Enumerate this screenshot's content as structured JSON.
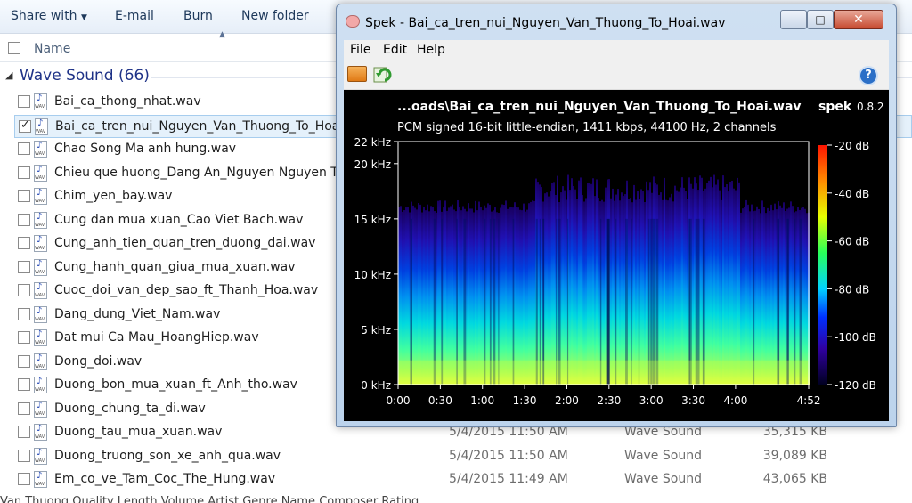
{
  "explorer": {
    "toolbar": {
      "share_with": "Share with",
      "email": "E-mail",
      "burn": "Burn",
      "new_folder": "New folder"
    },
    "column_name": "Name",
    "group": {
      "title": "Wave Sound (66)"
    },
    "files": [
      {
        "name": "Bai_ca_thong_nhat.wav",
        "date": "",
        "type": "",
        "size": "",
        "selected": false
      },
      {
        "name": "Bai_ca_tren_nui_Nguyen_Van_Thuong_To_Hoai.wav",
        "date": "",
        "type": "",
        "size": "",
        "selected": true
      },
      {
        "name": "Chao Song Ma anh hung.wav",
        "date": "",
        "type": "",
        "size": "",
        "selected": false
      },
      {
        "name": "Chieu que huong_Dang An_Nguyen Nguyen Thua",
        "date": "",
        "type": "",
        "size": "",
        "selected": false
      },
      {
        "name": "Chim_yen_bay.wav",
        "date": "",
        "type": "",
        "size": "",
        "selected": false
      },
      {
        "name": "Cung dan mua xuan_Cao Viet Bach.wav",
        "date": "",
        "type": "",
        "size": "",
        "selected": false
      },
      {
        "name": "Cung_anh_tien_quan_tren_duong_dai.wav",
        "date": "",
        "type": "",
        "size": "",
        "selected": false
      },
      {
        "name": "Cung_hanh_quan_giua_mua_xuan.wav",
        "date": "",
        "type": "",
        "size": "",
        "selected": false
      },
      {
        "name": "Cuoc_doi_van_dep_sao_ft_Thanh_Hoa.wav",
        "date": "",
        "type": "",
        "size": "",
        "selected": false
      },
      {
        "name": "Dang_dung_Viet_Nam.wav",
        "date": "",
        "type": "",
        "size": "",
        "selected": false
      },
      {
        "name": "Dat mui Ca Mau_HoangHiep.wav",
        "date": "",
        "type": "",
        "size": "",
        "selected": false
      },
      {
        "name": "Dong_doi.wav",
        "date": "",
        "type": "",
        "size": "",
        "selected": false
      },
      {
        "name": "Duong_bon_mua_xuan_ft_Anh_tho.wav",
        "date": "",
        "type": "",
        "size": "",
        "selected": false
      },
      {
        "name": "Duong_chung_ta_di.wav",
        "date": "",
        "type": "",
        "size": "",
        "selected": false
      },
      {
        "name": "Duong_tau_mua_xuan.wav",
        "date": "5/4/2015 11:50 AM",
        "type": "Wave Sound",
        "size": "35,315 KB",
        "selected": false
      },
      {
        "name": "Duong_truong_son_xe_anh_qua.wav",
        "date": "5/4/2015 11:50 AM",
        "type": "Wave Sound",
        "size": "39,089 KB",
        "selected": false
      },
      {
        "name": "Em_co_ve_Tam_Coc_The_Hung.wav",
        "date": "5/4/2015 11:49 AM",
        "type": "Wave Sound",
        "size": "43,065 KB",
        "selected": false
      }
    ],
    "bottom_text": "Van Thuong   Quality   Length   Volume   Artist   Genre   Name   Composer   Rating"
  },
  "spek": {
    "window_title": "Spek - Bai_ca_tren_nui_Nguyen_Van_Thuong_To_Hoai.wav",
    "menu": [
      "File",
      "Edit",
      "Help"
    ],
    "file_label": "...oads\\Bai_ca_tren_nui_Nguyen_Van_Thuong_To_Hoai.wav",
    "app_name": "spek",
    "version": "0.8.2",
    "audio_info": "PCM signed 16-bit little-endian, 1411 kbps, 44100 Hz, 2 channels",
    "freq_ticks": [
      {
        "label": "22 kHz",
        "khz": 22
      },
      {
        "label": "20 kHz",
        "khz": 20
      },
      {
        "label": "15 kHz",
        "khz": 15
      },
      {
        "label": "10 kHz",
        "khz": 10
      },
      {
        "label": "5 kHz",
        "khz": 5
      },
      {
        "label": "0 kHz",
        "khz": 0
      }
    ],
    "time_ticks": [
      {
        "label": "0:00",
        "sec": 0
      },
      {
        "label": "0:30",
        "sec": 30
      },
      {
        "label": "1:00",
        "sec": 60
      },
      {
        "label": "1:30",
        "sec": 90
      },
      {
        "label": "2:00",
        "sec": 120
      },
      {
        "label": "2:30",
        "sec": 150
      },
      {
        "label": "3:00",
        "sec": 180
      },
      {
        "label": "3:30",
        "sec": 210
      },
      {
        "label": "4:00",
        "sec": 240
      },
      {
        "label": "4:52",
        "sec": 292
      }
    ],
    "db_ticks": [
      {
        "label": "-20 dB",
        "db": -20
      },
      {
        "label": "-40 dB",
        "db": -40
      },
      {
        "label": "-60 dB",
        "db": -60
      },
      {
        "label": "-80 dB",
        "db": -80
      },
      {
        "label": "-100 dB",
        "db": -100
      },
      {
        "label": "-120 dB",
        "db": -120
      }
    ],
    "colors": {
      "scale": [
        "#fff200",
        "#ff8c00",
        "#ff0000",
        "#c80090",
        "#5000c8",
        "#000080",
        "#000000"
      ]
    }
  }
}
